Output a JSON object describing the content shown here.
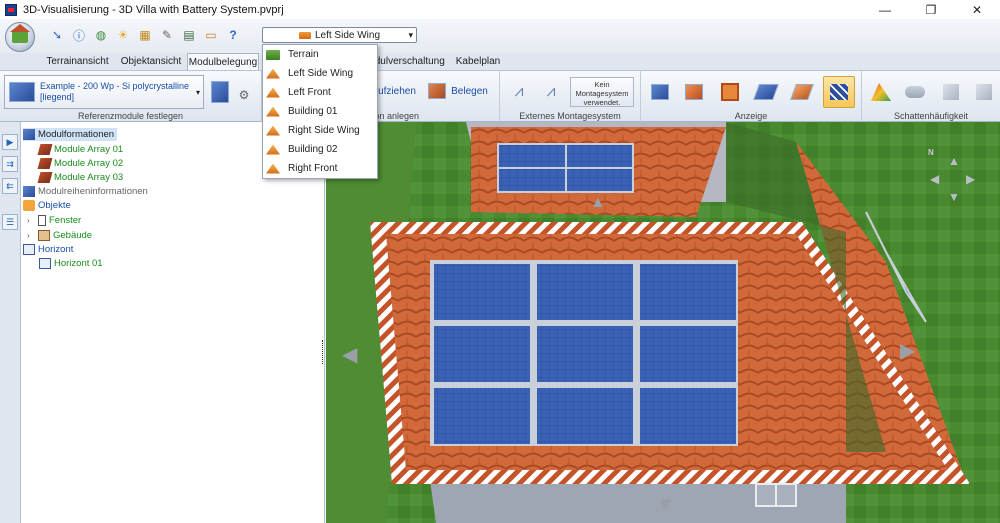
{
  "window": {
    "title": "3D-Visualisierung - 3D Villa with Battery System.pvprj",
    "minimize_glyph": "—",
    "maximize_glyph": "❐",
    "close_glyph": "✕"
  },
  "view_selector": {
    "value": "Left Side Wing",
    "caret": "▾",
    "options": [
      "Terrain",
      "Left Side Wing",
      "Left Front",
      "Building 01",
      "Right Side Wing",
      "Building 02",
      "Right Front"
    ]
  },
  "tabs": [
    "Terrainansicht",
    "Objektansicht",
    "Modulbelegung",
    "",
    "odulverschaltung",
    "Kabelplan"
  ],
  "ribbon": {
    "module_line1": "Example - 200 Wp - Si polycrystalline",
    "module_line2": "[liegend]",
    "caret": "▾",
    "btn_aufziehen": "ufziehen",
    "btn_belegen": "Belegen",
    "kein_line1": "Kein",
    "kein_line2": "Montagesystem",
    "kein_line3": "verwendet.",
    "group_referenz": "Referenzmodule festlegen",
    "group_information": "nformation anlegen",
    "group_extern": "Externes Montagesystem",
    "group_anzeige": "Anzeige",
    "group_schatten": "Schattenhäufigkeit"
  },
  "tree": {
    "modulformationen": "Modulformationen",
    "array1": "Module Array 01",
    "array2": "Module Array 02",
    "array3": "Module Array 03",
    "modulreihen": "Modulreiheninformationen",
    "objekte": "Objekte",
    "fenster": "Fenster",
    "gebaeude": "Gebäude",
    "horizont": "Horizont",
    "horizont01": "Horizont 01",
    "expander_glyph": "›"
  },
  "colors": {
    "accent": "#1a4da8",
    "green_text": "#1a8a1a",
    "roof": "#d56a3a",
    "grass": "#4a8a2f",
    "panel": "#2d4f9e",
    "selection": "#f7c65a"
  },
  "icons": {
    "app": "pv-app-icon",
    "orb": "house-orb-icon",
    "qat": [
      "arrow-icon",
      "info-icon",
      "globe-icon",
      "sun-icon",
      "grid-icon",
      "wrench-icon",
      "book-icon",
      "folder-icon",
      "help-icon"
    ]
  },
  "qat_glyphs": [
    "➘",
    "ⓘ",
    "◍",
    "☀",
    "▦",
    "✎",
    "▤",
    "▭",
    "?"
  ],
  "nav_glyphs": {
    "north": "N",
    "left": "◀",
    "right": "▶",
    "down": "▼",
    "up": "▲"
  }
}
